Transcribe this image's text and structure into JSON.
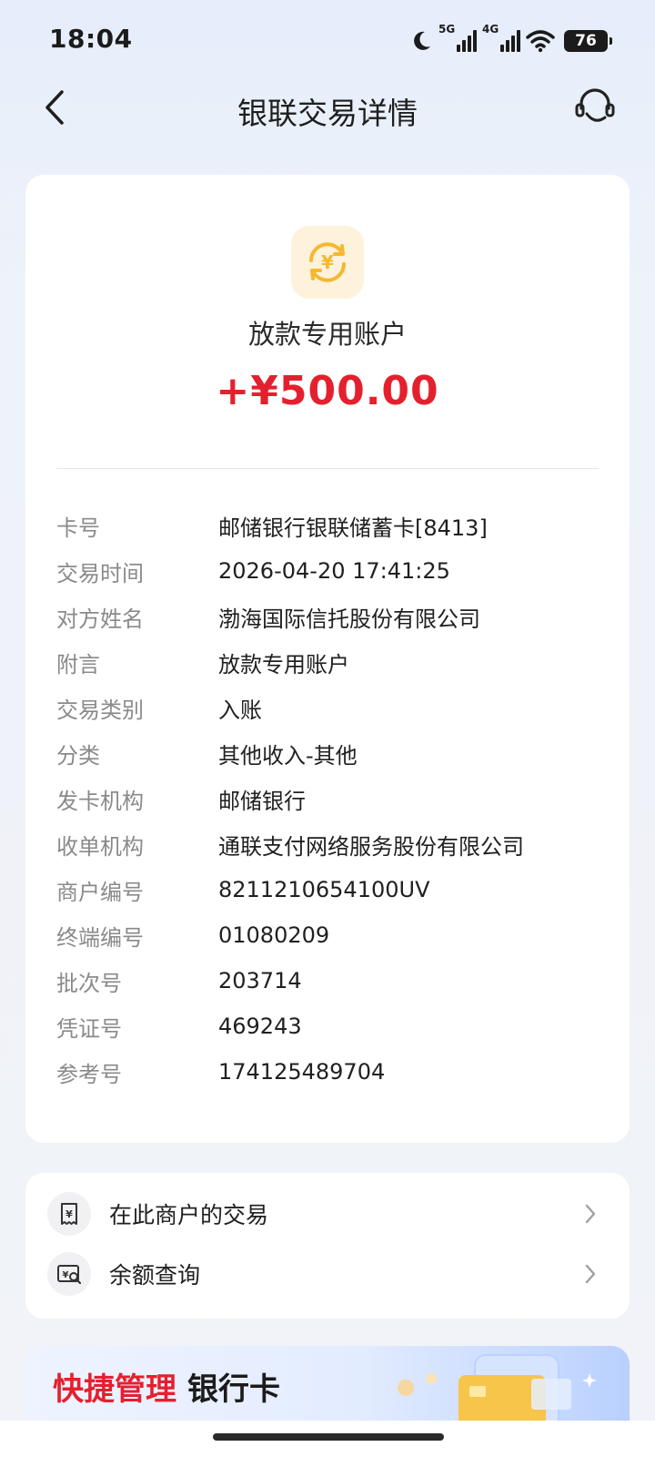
{
  "status_bar": {
    "time": "18:04",
    "network_1": "5G",
    "network_2": "4G",
    "battery": "76"
  },
  "nav": {
    "title": "银联交易详情",
    "back_icon": "chevron-left-icon",
    "service_icon": "customer-service-headset-icon"
  },
  "summary": {
    "icon": "yuan-exchange-icon",
    "payee": "放款专用账户",
    "amount": "+¥500.00",
    "amount_color": "#e5202e"
  },
  "details": [
    {
      "label": "卡号",
      "value": "邮储银行银联储蓄卡[8413]"
    },
    {
      "label": "交易时间",
      "value": "2026-04-20 17:41:25"
    },
    {
      "label": "对方姓名",
      "value": "渤海国际信托股份有限公司"
    },
    {
      "label": "附言",
      "value": "放款专用账户"
    },
    {
      "label": "交易类别",
      "value": "入账"
    },
    {
      "label": "分类",
      "value": "其他收入-其他"
    },
    {
      "label": "发卡机构",
      "value": "邮储银行"
    },
    {
      "label": "收单机构",
      "value": "通联支付网络服务股份有限公司"
    },
    {
      "label": "商户编号",
      "value": "8211210654100UV"
    },
    {
      "label": "终端编号",
      "value": "01080209"
    },
    {
      "label": "批次号",
      "value": "203714"
    },
    {
      "label": "凭证号",
      "value": "469243"
    },
    {
      "label": "参考号",
      "value": "174125489704"
    }
  ],
  "actions": [
    {
      "label": "在此商户的交易",
      "icon": "receipt-icon"
    },
    {
      "label": "余额查询",
      "icon": "balance-search-icon"
    }
  ],
  "banner": {
    "accent": "快捷管理",
    "main": "银行卡"
  }
}
